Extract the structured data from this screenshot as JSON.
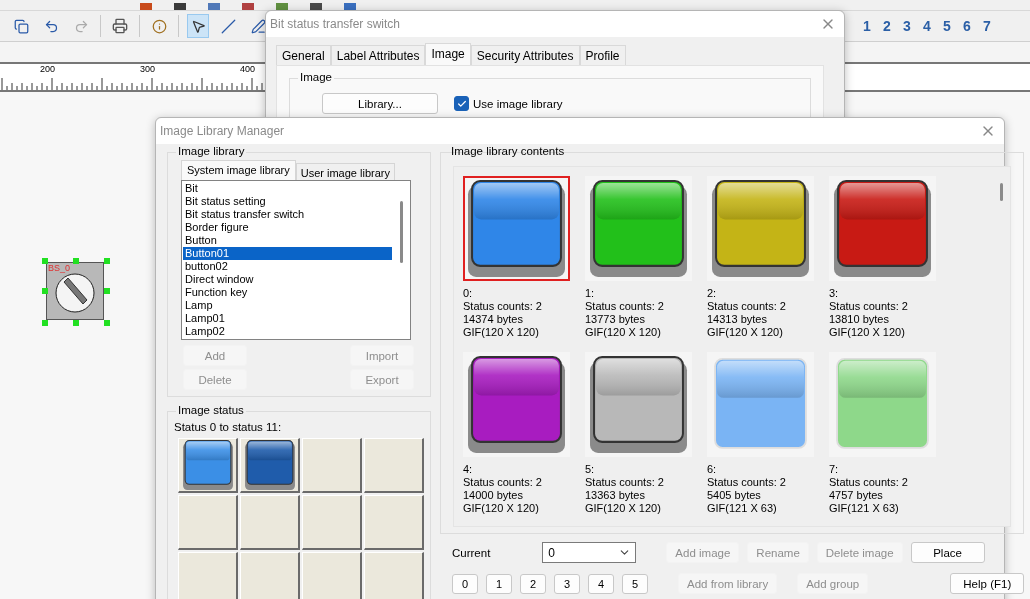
{
  "app": {
    "ruler_labels": [
      "200",
      "300",
      "400"
    ],
    "page_buttons": [
      "1",
      "2",
      "3",
      "4",
      "5",
      "6",
      "7"
    ],
    "canvas_object": {
      "label": "BS_0",
      "selected": true
    }
  },
  "property_dialog": {
    "title": "Bit status transfer switch",
    "tabs": [
      {
        "label": "General",
        "selected": false
      },
      {
        "label": "Label Attributes",
        "selected": false
      },
      {
        "label": "Image",
        "selected": true
      },
      {
        "label": "Security Attributes",
        "selected": false
      },
      {
        "label": "Profile",
        "selected": false
      }
    ],
    "group_title": "Image",
    "library_button": "Library...",
    "use_library": {
      "label": "Use image library",
      "checked": true
    }
  },
  "manager": {
    "title": "Image Library Manager",
    "library_group": "Image library",
    "library_tabs": [
      {
        "label": "System image library",
        "selected": true
      },
      {
        "label": "User image library",
        "selected": false
      }
    ],
    "library_items": [
      {
        "label": "Bit",
        "selected": false
      },
      {
        "label": "Bit status setting",
        "selected": false
      },
      {
        "label": "Bit status transfer switch",
        "selected": false
      },
      {
        "label": "Border figure",
        "selected": false
      },
      {
        "label": "Button",
        "selected": false
      },
      {
        "label": "Button01",
        "selected": true
      },
      {
        "label": "button02",
        "selected": false
      },
      {
        "label": "Direct window",
        "selected": false
      },
      {
        "label": "Function key",
        "selected": false
      },
      {
        "label": "Lamp",
        "selected": false
      },
      {
        "label": "Lamp01",
        "selected": false
      },
      {
        "label": "Lamp02",
        "selected": false
      }
    ],
    "library_buttons": [
      {
        "label": "Add",
        "disabled": true
      },
      {
        "label": "Import",
        "disabled": true
      },
      {
        "label": "Delete",
        "disabled": true
      },
      {
        "label": "Export",
        "disabled": true
      }
    ],
    "status_group": "Image status",
    "status_caption": "Status 0 to status 11:",
    "status_slots": [
      {
        "kind": "image",
        "color": "#3b8fe6"
      },
      {
        "kind": "image",
        "color": "#1f5cab"
      },
      {
        "kind": "empty"
      },
      {
        "kind": "empty"
      },
      {
        "kind": "empty"
      },
      {
        "kind": "empty"
      },
      {
        "kind": "empty"
      },
      {
        "kind": "empty"
      },
      {
        "kind": "empty"
      },
      {
        "kind": "empty"
      },
      {
        "kind": "empty"
      },
      {
        "kind": "empty"
      }
    ],
    "contents_group": "Image library contents",
    "images": [
      {
        "kind": "square",
        "index": "0:",
        "status_counts": "Status counts: 2",
        "size": "14374 bytes",
        "format": "GIF(120 X 120)",
        "color": "#2f86e8",
        "selected": true
      },
      {
        "kind": "square",
        "index": "1:",
        "status_counts": "Status counts: 2",
        "size": "13773 bytes",
        "format": "GIF(120 X 120)",
        "color": "#22c01a",
        "selected": false
      },
      {
        "kind": "square",
        "index": "2:",
        "status_counts": "Status counts: 2",
        "size": "14313 bytes",
        "format": "GIF(120 X 120)",
        "color": "#c4b416",
        "selected": false
      },
      {
        "kind": "square",
        "index": "3:",
        "status_counts": "Status counts: 2",
        "size": "13810 bytes",
        "format": "GIF(120 X 120)",
        "color": "#c81a14",
        "selected": false
      },
      {
        "kind": "square",
        "index": "4:",
        "status_counts": "Status counts: 2",
        "size": "14000 bytes",
        "format": "GIF(120 X 120)",
        "color": "#a81cc0",
        "selected": false
      },
      {
        "kind": "square",
        "index": "5:",
        "status_counts": "Status counts: 2",
        "size": "13363 bytes",
        "format": "GIF(120 X 120)",
        "color": "#b8b8b8",
        "selected": false
      },
      {
        "kind": "wide",
        "index": "6:",
        "status_counts": "Status counts: 2",
        "size": "5405 bytes",
        "format": "GIF(121 X 63)",
        "color": "#7ab4f4",
        "selected": false
      },
      {
        "kind": "wide",
        "index": "7:",
        "status_counts": "Status counts: 2",
        "size": "4757 bytes",
        "format": "GIF(121 X 63)",
        "color": "#8ed88a",
        "selected": false
      }
    ],
    "current_label": "Current",
    "current_value": "0",
    "action_buttons": [
      {
        "label": "Add image",
        "disabled": true
      },
      {
        "label": "Rename",
        "disabled": true
      },
      {
        "label": "Delete image",
        "disabled": true
      },
      {
        "label": "Place",
        "disabled": false
      }
    ],
    "number_buttons": [
      "0",
      "1",
      "2",
      "3",
      "4",
      "5"
    ],
    "bottom_buttons": [
      {
        "label": "Add from library",
        "disabled": true
      },
      {
        "label": "Add group",
        "disabled": true
      },
      {
        "label": "Help (F1)",
        "disabled": false
      }
    ]
  }
}
